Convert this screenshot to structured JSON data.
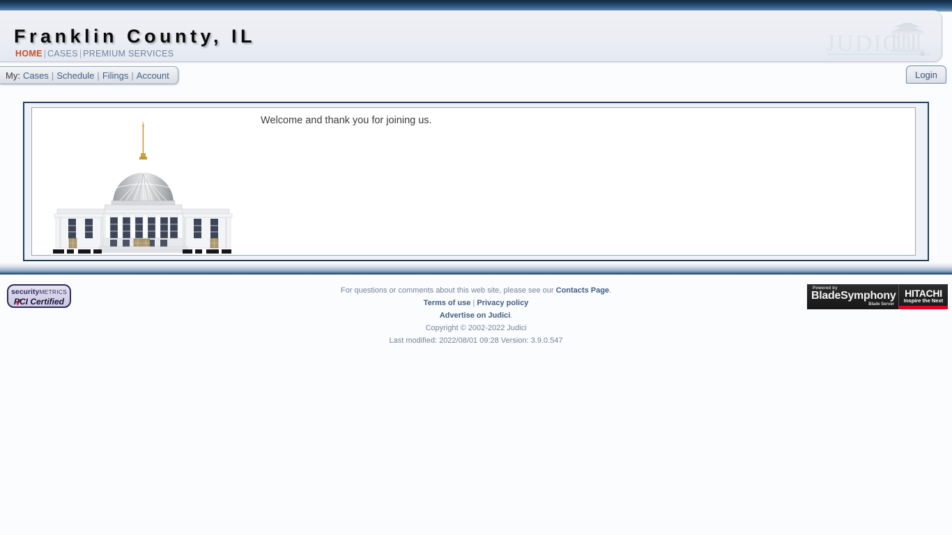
{
  "header": {
    "site_title": "Franklin County, IL",
    "nav": [
      {
        "label": "HOME",
        "active": true
      },
      {
        "label": "CASES",
        "active": false
      },
      {
        "label": "PREMIUM SERVICES",
        "active": false
      }
    ],
    "logo_text": "JUDICI",
    "logo_icon": "courthouse-pediment-icon"
  },
  "my_menu": {
    "prefix": "My:",
    "items": [
      {
        "label": "Cases"
      },
      {
        "label": "Schedule"
      },
      {
        "label": "Filings"
      },
      {
        "label": "Account"
      }
    ]
  },
  "login": {
    "label": "Login"
  },
  "main": {
    "welcome_message": "Welcome and thank you for joining us.",
    "illustration": "courthouse-illustration"
  },
  "footer": {
    "questions_prefix": "For questions or comments about this web site, please see our ",
    "contacts_link": "Contacts Page",
    "questions_suffix": ".",
    "terms_link": "Terms of use",
    "privacy_link": "Privacy policy",
    "link_separator": "|",
    "advertise_link": "Advertise on Judici",
    "advertise_suffix": ".",
    "copyright": "Copyright © 2002-2022 Judici",
    "last_modified": "Last modified: 2022/08/01 09:28 Version: 3.9.0.547"
  },
  "badges": {
    "pci": {
      "brand_part1": "security",
      "brand_part2": "METRICS",
      "certification": "PCI Certified",
      "check_glyph": "✓"
    },
    "hitachi": {
      "powered_by": "Powered by",
      "product": "BladeSymphony",
      "product_sub": "Blade Server",
      "company": "HITACHI",
      "tagline": "Inspire the Next"
    }
  },
  "colors": {
    "top_bar_dark": "#15263d",
    "active_nav": "#cc4c24",
    "link": "#44618a",
    "border_navy": "#1d3f5f",
    "hitachi_red": "#e60020"
  }
}
